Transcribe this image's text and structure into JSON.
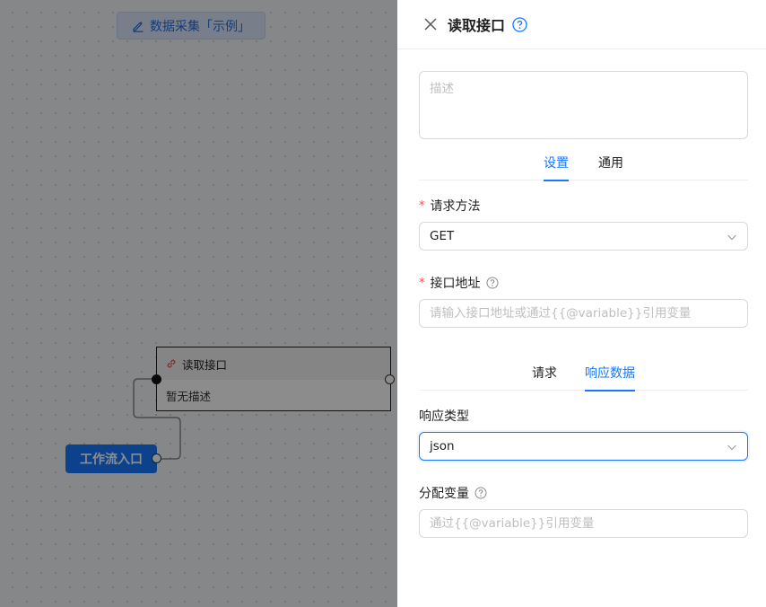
{
  "canvas": {
    "title_pill_label": "数据采集「示例」",
    "node": {
      "title": "读取接口",
      "description": "暂无描述"
    },
    "entry_node_label": "工作流入口"
  },
  "drawer": {
    "title": "读取接口",
    "description_placeholder": "描述",
    "tabs": [
      {
        "label": "设置",
        "active": true
      },
      {
        "label": "通用",
        "active": false
      }
    ],
    "request_method": {
      "label": "请求方法",
      "value": "GET"
    },
    "endpoint": {
      "label": "接口地址",
      "placeholder": "请输入接口地址或通过{{@variable}}引用变量"
    },
    "sub_tabs": [
      {
        "label": "请求",
        "active": false
      },
      {
        "label": "响应数据",
        "active": true
      }
    ],
    "response_type": {
      "label": "响应类型",
      "value": "json"
    },
    "assign_variable": {
      "label": "分配变量",
      "placeholder": "通过{{@variable}}引用变量"
    }
  },
  "colors": {
    "accent": "#1677ff",
    "required": "#ff4d4f",
    "node_icon": "#e5484d"
  },
  "icons": {
    "close": "close-icon",
    "help": "question-circle-icon",
    "edit": "edit-icon",
    "link": "link-icon",
    "chevron": "chevron-down-icon"
  }
}
